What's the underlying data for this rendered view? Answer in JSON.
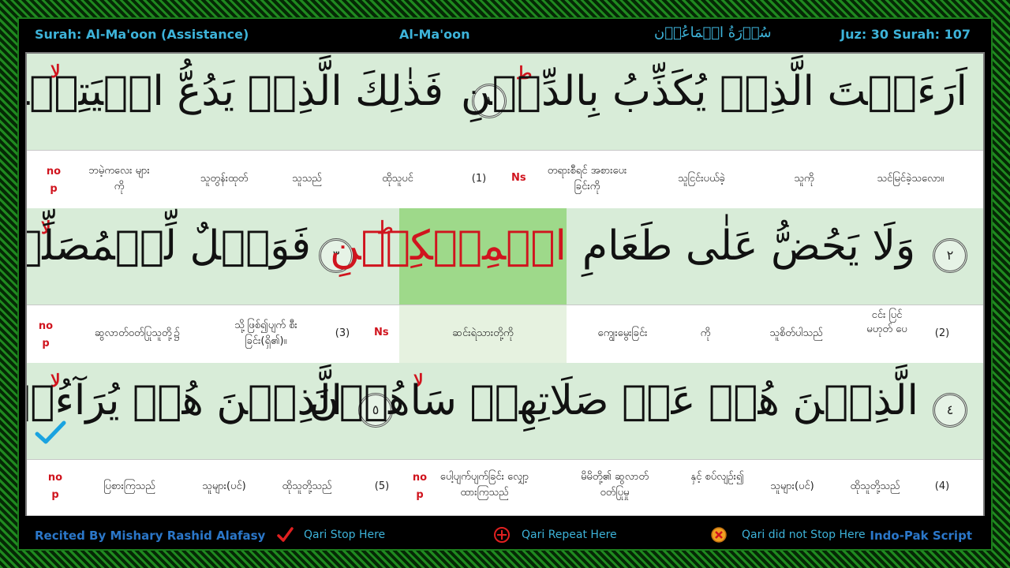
{
  "header": {
    "surah_label": "Surah: Al-Ma'oon (Assistance)",
    "surah_name": "Al-Ma'oon",
    "surah_arabic": "سُوۡرَةُ الۡمَاعُوۡن",
    "juz_surah": "Juz: 30  Surah: 107"
  },
  "rows": [
    {
      "arabic_main": "اَرَءَيۡتَ الَّذِىۡ يُكَذِّبُ بِالدِّيۡنِ",
      "ayah_a": "١",
      "arabic_second": "فَذٰلِكَ الَّذِىۡ يَدُعُّ الۡيَتِيۡمَ",
      "mark_left": "لا",
      "mark_right": "ط",
      "translations": {
        "nop": "no p",
        "c1": "ဘမဲ့ကလေး များကို",
        "c2": "သူတွန်းထုတ်",
        "c3": "သူသည်",
        "c4": "ထိုသူပင်",
        "c5": "(1)",
        "ns": "Ns",
        "c6": "တရားစီရင် အစားပေးခြင်းကို",
        "c7": "သူငြင်းပယ်ခဲ့",
        "c8": "သူကို",
        "c9": "သင်မြင်ခဲ့သလော။"
      }
    },
    {
      "arabic_right": "وَلَا يَحُضُّ عَلٰى طَعَامِ",
      "ayah_b": "٢",
      "arabic_highlight": "الۡمِسۡكِيۡنِ",
      "ayah_c": "٣",
      "arabic_left": "فَوَيۡلٌ لِّلۡمُصَلِّيۡنَ",
      "mark_left": "لا",
      "mark_right": "ط",
      "translations": {
        "nop": "no p",
        "c1": "ဆွလာတ်ဝတ်ပြုသူတို့၌",
        "c2": "သို့ဖြစ်၍ပျက် စီးခြင်း(ရှိ၏)။",
        "c3": "(3)",
        "ns": "Ns",
        "c4": "ဆင်းရဲသားတို့ကို",
        "c5": "ကျွေးမွေးခြင်း",
        "c6": "ကို",
        "c7": "သူစိတ်ပါသည်",
        "c8": "ငင်း ပြင် မဟုတ် ပေ",
        "c9": "(2)"
      }
    },
    {
      "arabic_right": "الَّذِيۡنَ هُمۡ عَنۡ صَلَاتِهِمۡ سَاهُوۡنَ",
      "ayah_d": "٤",
      "ayah_e": "٥",
      "arabic_left": "الَّذِيۡنَ هُمۡ يُرَآءُوۡنَ",
      "mark_left": "لا",
      "mark_mid": "لا",
      "translations": {
        "nop1": "no p",
        "c1": "ပြစားကြသည်",
        "c2": "သူများ(ပင်)",
        "c3": "ထိုသူတို့သည်",
        "c4": "(5)",
        "nop2": "no p",
        "c5": "ပေါ့ပျက်ပျက်ခြင်း လျှော့ထားကြသည်",
        "c6": "မိမိတို့၏ ဆွလာတ် ဝတ်ပြုမှု",
        "c7": "နှင့် စပ်လျဉ်း၍",
        "c8": "သူများ(ပင်)",
        "c9": "ထိုသူတို့သည်",
        "c10": "(4)"
      }
    }
  ],
  "footer": {
    "reciter": "Recited By Mishary Rashid Alafasy",
    "legend_stop": "Qari Stop Here",
    "legend_repeat": "Qari Repeat Here",
    "legend_nostop": "Qari did not Stop Here",
    "script": "Indo-Pak Script"
  },
  "colors": {
    "accent_blue": "#3db3d9",
    "stop_red": "#d0141e",
    "highlight_green": "#9ed98a",
    "row_green": "#d8ecd8"
  }
}
